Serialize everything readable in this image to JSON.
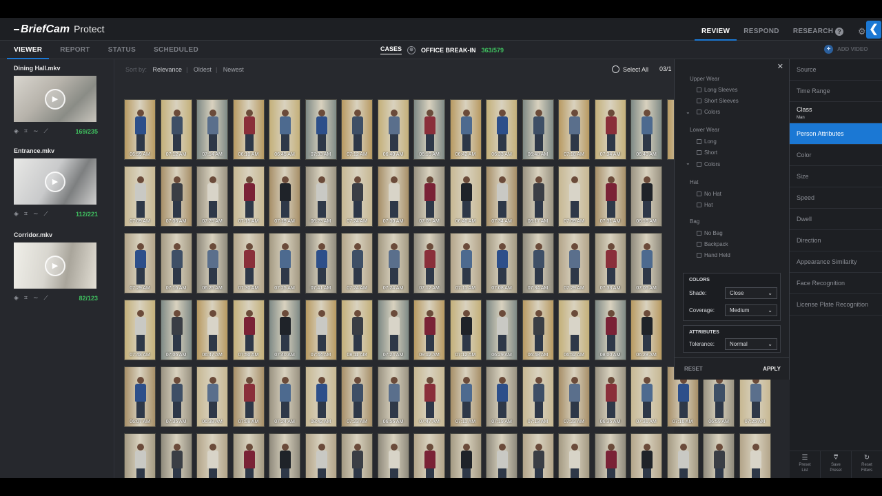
{
  "header": {
    "brand": "BriefCam",
    "product": "Protect",
    "nav": [
      "REVIEW",
      "RESPOND",
      "RESEARCH"
    ],
    "active_nav": "REVIEW",
    "help_glyph": "?",
    "gear_glyph": "⚙",
    "collapse_glyph": "❮"
  },
  "subbar": {
    "tabs": [
      "VIEWER",
      "REPORT",
      "STATUS",
      "SCHEDULED"
    ],
    "active_tab": "VIEWER",
    "cases_label": "CASES",
    "case_name": "OFFICE BREAK-IN",
    "case_count": "363/579",
    "add_video": "ADD VIDEO"
  },
  "videos": [
    {
      "title": "Dining Hall.mkv",
      "count": "169/235"
    },
    {
      "title": "Entrance.mkv",
      "count": "112/221"
    },
    {
      "title": "Corridor.mkv",
      "count": "82/123"
    }
  ],
  "sort": {
    "label": "Sort by:",
    "options": [
      "Relevance",
      "Oldest",
      "Newest"
    ],
    "select_all": "Select All",
    "pager": "03/1"
  },
  "grid_rows": [
    [
      "06:59 AM",
      "07:12 AM",
      "07:14 AM",
      "06:10 AM",
      "06:45 AM",
      "07:33 AM",
      "07:12 AM",
      "06:40 AM",
      "06:16 AM",
      "06:42 AM",
      "06:33 AM",
      "06:48 AM",
      "07:18 AM",
      "07:34 AM",
      "06:40 AM",
      ""
    ],
    [
      "07:09 AM",
      "07:06 AM",
      "07:25 AM",
      "07:15 AM",
      "07:19 AM",
      "06:23 AM",
      "07:24 AM",
      "07:30 AM",
      "07:05 AM",
      "06:40 AM",
      "07:34 AM",
      "06:17 AM",
      "07:09 AM",
      "07:31 AM",
      "06:16 AM"
    ],
    [
      "07:29 AM",
      "07:16 AM",
      "06:25 AM",
      "07:30 AM",
      "07:25 AM",
      "07:41 AM",
      "07:24 AM",
      "07:24 AM",
      "07:12 AM",
      "07:11 AM",
      "07:08 AM",
      "07:34 AM",
      "07:29 AM",
      "07:33 AM",
      "07:06 AM"
    ],
    [
      "07:43 AM",
      "07:06 AM",
      "06:47 AM",
      "07:50 AM",
      "07:40 AM",
      "07:44 AM",
      "08:11 AM",
      "07:24 AM",
      "09:12 AM",
      "07:12 AM",
      "06:29 AM",
      "06:48 AM",
      "06:52 AM",
      "08:00 AM",
      "06:28 AM"
    ],
    [
      "06:07 AM",
      "07:35 AM",
      "06:38 AM",
      "07:08 AM",
      "07:24 AM",
      "08:42 AM",
      "07:23 AM",
      "06:56 AM",
      "07:47 AM",
      "07:11 AM",
      "07:19 AM",
      "07:13 AM",
      "07:23 AM",
      "06:35 AM",
      "07:31 AM",
      "07:16 AM",
      "06:59 AM",
      "07:25 AM"
    ],
    [
      "",
      "",
      "",
      "",
      "",
      "",
      "",
      "",
      "",
      "",
      "",
      "",
      "",
      "",
      "",
      "",
      "",
      ""
    ]
  ],
  "filter": {
    "close_glyph": "✕",
    "upper_wear": {
      "title": "Upper Wear",
      "options": [
        "Long Sleeves",
        "Short Sleeves",
        "Colors"
      ]
    },
    "lower_wear": {
      "title": "Lower Wear",
      "options": [
        "Long",
        "Short",
        "Colors"
      ]
    },
    "hat": {
      "title": "Hat",
      "options": [
        "No Hat",
        "Hat"
      ]
    },
    "bag": {
      "title": "Bag",
      "options": [
        "No Bag",
        "Backpack",
        "Hand Held"
      ]
    },
    "colors": {
      "title": "COLORS",
      "shade_label": "Shade:",
      "shade_value": "Close",
      "coverage_label": "Coverage:",
      "coverage_value": "Medium"
    },
    "attributes": {
      "title": "ATTRIBUTES",
      "tolerance_label": "Tolerance:",
      "tolerance_value": "Normal"
    },
    "reset": "RESET",
    "apply": "APPLY"
  },
  "right_panel": {
    "items": [
      "Source",
      "Time Range",
      "Class",
      "Person Attributes",
      "Color",
      "Size",
      "Speed",
      "Dwell",
      "Direction",
      "Appearance Similarity",
      "Face Recognition",
      "License Plate Recognition"
    ],
    "class_sub": "Man",
    "active": "Person Attributes",
    "footer": [
      {
        "l1": "Preset",
        "l2": "List"
      },
      {
        "l1": "Save",
        "l2": "Preset"
      },
      {
        "l1": "Reset",
        "l2": "Filters"
      }
    ]
  }
}
